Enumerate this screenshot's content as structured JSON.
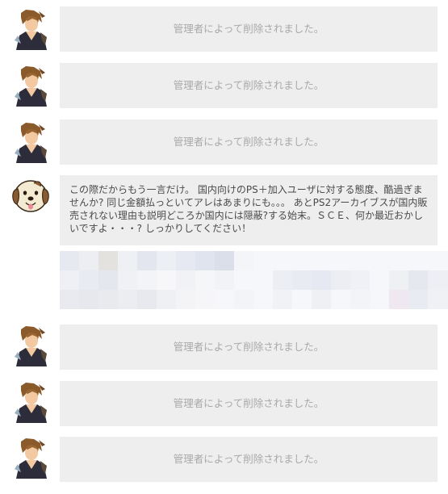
{
  "thread": {
    "deleted_message": "管理者によって削除されました。",
    "comments": [
      {
        "type": "deleted",
        "avatar": "game-character-avatar"
      },
      {
        "type": "deleted",
        "avatar": "game-character-avatar"
      },
      {
        "type": "deleted",
        "avatar": "game-character-avatar"
      },
      {
        "type": "comment",
        "avatar": "cartoon-dog-avatar",
        "text": "この際だからもう一言だけ。 国内向けのPS＋加入ユーザに対する態度、酷過ぎませんか? 同じ金額払っといてアレはあまりにも。。。 あとPS2アーカイブスが国内販売されない理由も説明どころか国内には隠蔽?する始末。ＳＣＥ、何か最近おかしいですよ・・・? しっかりしてください！"
      },
      {
        "type": "deleted",
        "avatar": "game-character-avatar"
      },
      {
        "type": "deleted",
        "avatar": "game-character-avatar"
      },
      {
        "type": "deleted",
        "avatar": "game-character-avatar"
      }
    ]
  },
  "colors": {
    "bubble_bg": "#eeeeee",
    "deleted_text": "#a9a9a9",
    "comment_text": "#4a4a4a"
  }
}
